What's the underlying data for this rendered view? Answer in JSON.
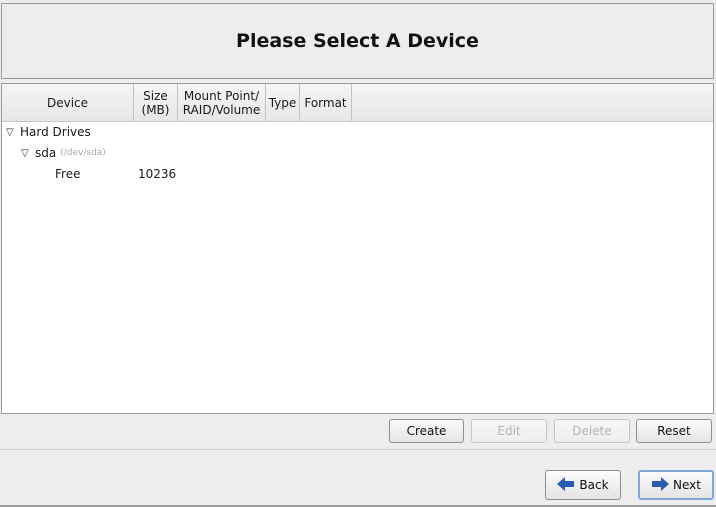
{
  "header": {
    "title": "Please Select A Device"
  },
  "columns": {
    "device": "Device",
    "size_1": "Size",
    "size_2": "(MB)",
    "mount_1": "Mount Point/",
    "mount_2": "RAID/Volume",
    "type": "Type",
    "format": "Format"
  },
  "tree": {
    "group": {
      "label": "Hard Drives"
    },
    "disk": {
      "label": "sda",
      "path": "(/dev/sda)"
    },
    "free": {
      "label": "Free",
      "size": "10236"
    }
  },
  "actions": {
    "create": "Create",
    "edit": "Edit",
    "delete": "Delete",
    "reset": "Reset"
  },
  "nav": {
    "back": "Back",
    "next": "Next"
  },
  "colors": {
    "back_arrow": "#2a5db0",
    "next_arrow": "#2a5db0",
    "focus_ring": "#7fa8d8"
  }
}
